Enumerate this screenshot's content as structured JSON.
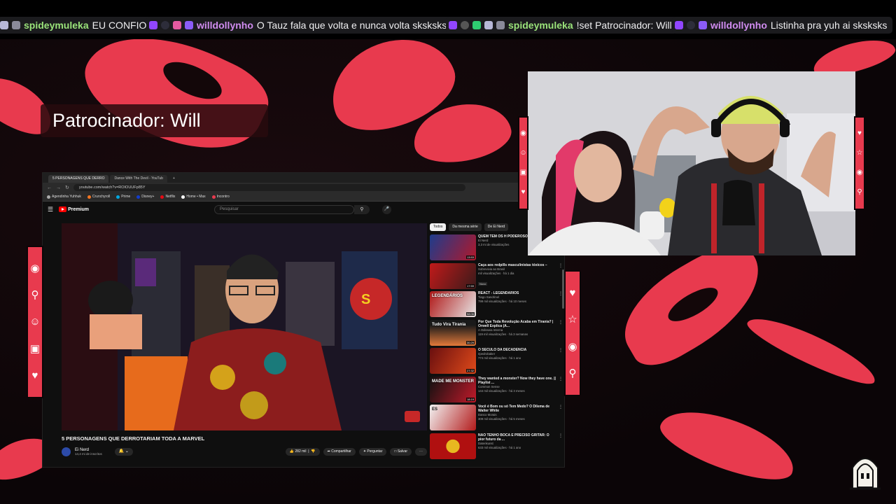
{
  "chat": {
    "messages": [
      {
        "user": "spideymuleka",
        "text": "EU CONFIO",
        "color": "#9ae37a"
      },
      {
        "user": "willdollynho",
        "text": "O Tauz fala que volta e nunca volta sksksks",
        "color": "#d08cf0"
      },
      {
        "user": "spideymuleka",
        "text": "!set Patrocinador: Will",
        "color": "#9ae37a"
      },
      {
        "user": "willdollynho",
        "text": "Listinha pra yuh ai sksksks",
        "color": "#d08cf0"
      }
    ]
  },
  "overlay": {
    "sponsor": "Patrocinador: Will"
  },
  "browser": {
    "tabs": [
      "5 PERSONAGENS QUE DERRO",
      "Dance With The Devil - YouTub"
    ],
    "new_tab": "+",
    "url": "youtube.com/watch?v=ROIOUUFp85Y",
    "bookmarks": [
      "Agendinha Yuhhuk",
      "Crunchyroll",
      "Prime",
      "Disney+",
      "Netflix",
      "Home • Max",
      "Incontro"
    ]
  },
  "youtube": {
    "logo": "Premium",
    "search_placeholder": "Pesquisar",
    "video_title": "5 PERSONAGENS QUE DERROTARIAM TODA A MARVEL",
    "channel": "Ei Nerd",
    "subscribers": "14,4 mi de inscritos",
    "likes": "282 mil",
    "share": "Compartilhar",
    "ask": "Perguntar",
    "save": "Salvar",
    "chips": [
      "Todos",
      "Da mesma série",
      "De Ei Nerd"
    ],
    "recommendations": [
      {
        "title": "QUEM TEM OS H PODEROSOS, MA",
        "channel": "Ei Nerd",
        "meta": "3,3 mi de visualizações",
        "duration": "13:53",
        "thumb_text": "",
        "new": false
      },
      {
        "title": "Caça aos redpills masculinistas tóxicos –",
        "channel": "Sobrevivia ao Brasil",
        "meta": "mil visualizações · há 1 dia",
        "duration": "17:59",
        "thumb_text": "",
        "new": true
      },
      {
        "title": "REACT - LEGENDÁRIOS",
        "channel": "Tiago Sandrinel",
        "meta": "799 mil visualizações · há 10 meses",
        "duration": "58:06",
        "thumb_text": "LEGENDÁRIOS",
        "new": false
      },
      {
        "title": "Por Que Toda Revolução Acaba em Tirania? | Orwell Explica (A...",
        "channel": "A Odisseia Interna",
        "meta": "119 mil visualizações · há 3 semanas",
        "duration": "30:29",
        "thumb_text": "Tudo Vira Tirania",
        "new": false
      },
      {
        "title": "O SÉCULO DA DECADÊNCIA",
        "channel": "ripedrobaker",
        "meta": "774 mil visualizações · há 1 ano",
        "duration": "27:32",
        "thumb_text": "",
        "new": false
      },
      {
        "title": "They wanted a monster? Now they have one. || Playlist ...",
        "channel": "Common Sense",
        "meta": "144 mil visualizações · há 3 meses",
        "duration": "18:19",
        "thumb_text": "MADE ME MONSTER",
        "new": false
      },
      {
        "title": "Você é Bom ou só Tem Medo? O Dilema de Walter White",
        "channel": "Danco Morais",
        "meta": "309 mil visualizações · há 5 meses",
        "duration": "",
        "thumb_text": "ES",
        "new": false
      },
      {
        "title": "NÃO TENHO BOCA E PRECISO GRITAR: O pior futuro da ...",
        "channel": "Datenkunst",
        "meta": "633 mil visualizações · há 1 ano",
        "duration": "",
        "thumb_text": "",
        "new": false
      }
    ]
  },
  "colors": {
    "accent": "#e83a4e",
    "bg": "#0b0507",
    "yt_red": "#ff0000"
  }
}
